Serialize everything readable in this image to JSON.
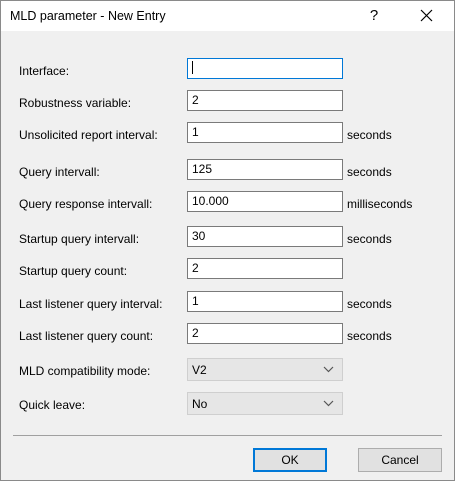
{
  "window": {
    "title": "MLD parameter - New Entry",
    "help_label": "?"
  },
  "form": {
    "interface": {
      "label": "Interface:",
      "value": ""
    },
    "robustness": {
      "label": "Robustness variable:",
      "value": "2"
    },
    "unsolicited": {
      "label": "Unsolicited report interval:",
      "value": "1",
      "unit": "seconds"
    },
    "query_interval": {
      "label": "Query intervall:",
      "value": "125",
      "unit": "seconds"
    },
    "query_response": {
      "label": "Query response intervall:",
      "value": "10.000",
      "unit": "milliseconds"
    },
    "startup_interval": {
      "label": "Startup query intervall:",
      "value": "30",
      "unit": "seconds"
    },
    "startup_count": {
      "label": "Startup query count:",
      "value": "2"
    },
    "last_listener_interval": {
      "label": "Last listener query interval:",
      "value": "1",
      "unit": "seconds"
    },
    "last_listener_count": {
      "label": "Last listener query count:",
      "value": "2",
      "unit": "seconds"
    },
    "compat_mode": {
      "label": "MLD compatibility mode:",
      "value": "V2"
    },
    "quick_leave": {
      "label": "Quick leave:",
      "value": "No"
    }
  },
  "buttons": {
    "ok_label": "OK",
    "cancel_label": "Cancel"
  },
  "colors": {
    "accent": "#0078d7",
    "dialog_bg": "#f0f0f0"
  }
}
